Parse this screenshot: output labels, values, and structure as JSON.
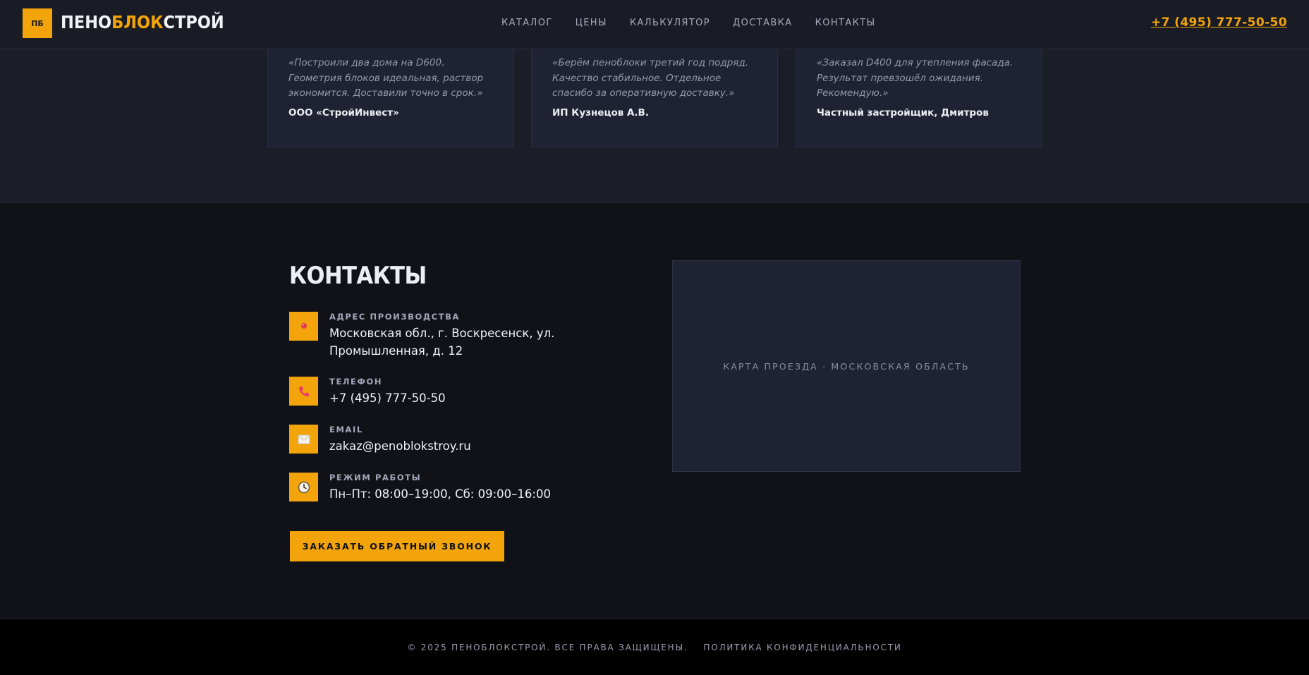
{
  "header": {
    "logo_mark": "ПБ",
    "logo_part1": "ПЕНО",
    "logo_part2": "БЛОК",
    "logo_part3": "СТРОЙ",
    "nav": [
      "КАТАЛОГ",
      "ЦЕНЫ",
      "КАЛЬКУЛЯТОР",
      "ДОСТАВКА",
      "КОНТАКТЫ"
    ],
    "phone": "+7 (495) 777-50-50"
  },
  "reviews": [
    {
      "quote": "«Построили два дома на D600. Геометрия блоков идеальная, раствор экономится. Доставили точно в срок.»",
      "author": "ООО «СтройИнвест»"
    },
    {
      "quote": "«Берём пеноблоки третий год подряд. Качество стабильное. Отдельное спасибо за оперативную доставку.»",
      "author": "ИП Кузнецов А.В."
    },
    {
      "quote": "«Заказал D400 для утепления фасада. Результат превзошёл ожидания. Рекомендую.»",
      "author": "Частный застройщик, Дмитров"
    }
  ],
  "contacts": {
    "title": "КОНТАКТЫ",
    "items": [
      {
        "icon": "pin-icon",
        "label": "АДРЕС ПРОИЗВОДСТВА",
        "value": "Московская обл., г. Воскресенск, ул. Промышленная, д. 12"
      },
      {
        "icon": "phone-icon",
        "label": "ТЕЛЕФОН",
        "value": "+7 (495) 777-50-50"
      },
      {
        "icon": "envelope-icon",
        "label": "EMAIL",
        "value": "zakaz@penoblokstroy.ru"
      },
      {
        "icon": "clock-icon",
        "label": "РЕЖИМ РАБОТЫ",
        "value": "Пн–Пт: 08:00–19:00, Сб: 09:00–16:00"
      }
    ],
    "callback_label": "ЗАКАЗАТЬ ОБРАТНЫЙ ЗВОНОК",
    "map_label": "КАРТА ПРОЕЗДА · МОСКОВСКАЯ ОБЛАСТЬ"
  },
  "footer": {
    "copyright": "© 2025 ПЕНОБЛОКСТРОЙ. ВСЕ ПРАВА ЗАЩИЩЕНЫ.",
    "privacy": "ПОЛИТИКА КОНФИДЕНЦИАЛЬНОСТИ"
  },
  "colors": {
    "accent": "#f2a40a",
    "header_bg": "#1a1c25",
    "section_bg": "#1b1d28",
    "contacts_bg": "#111218",
    "footer_bg": "#000000"
  }
}
